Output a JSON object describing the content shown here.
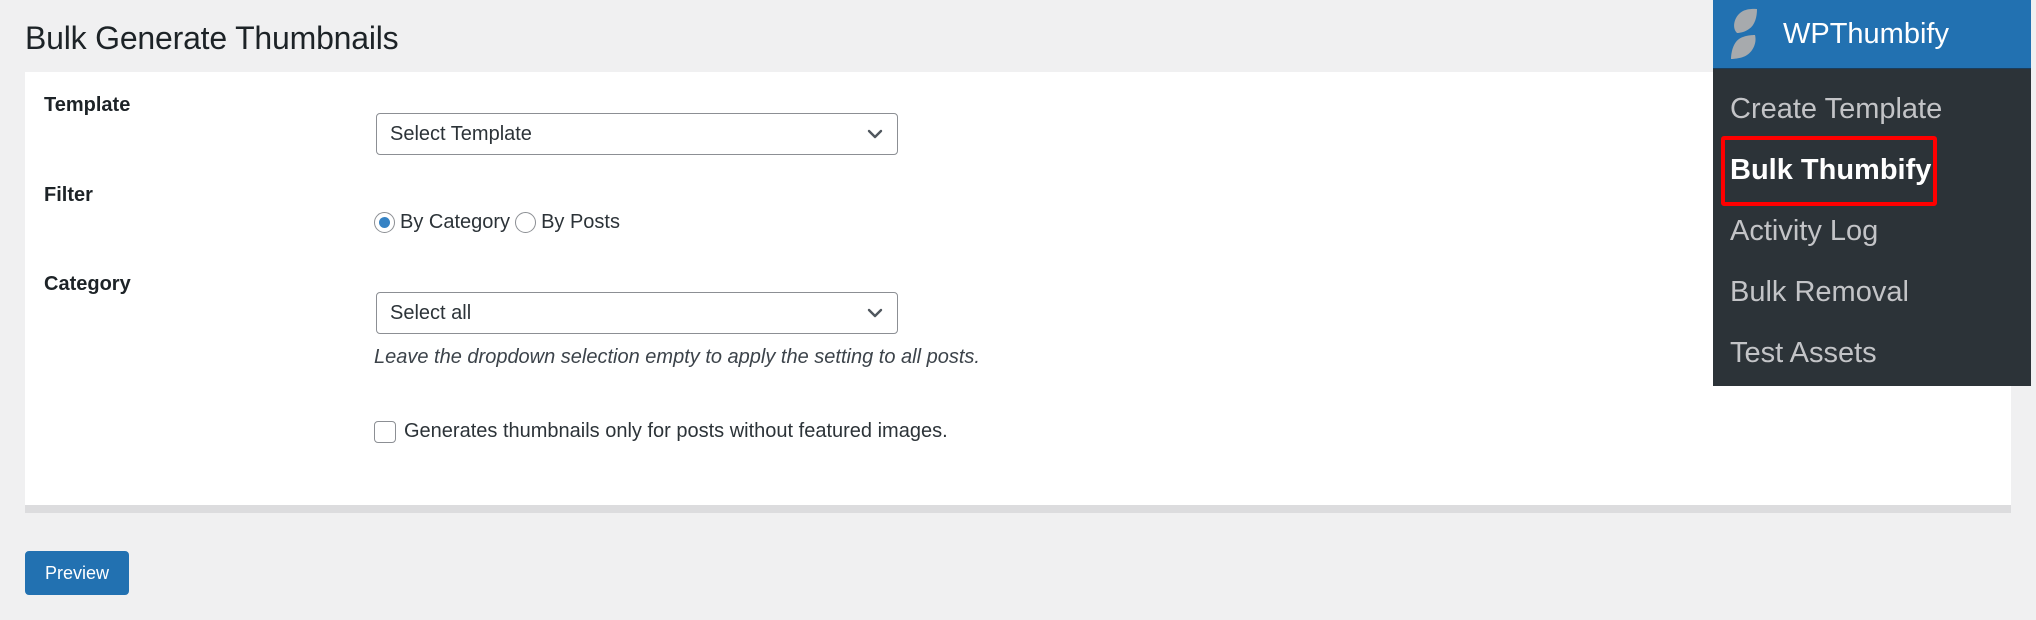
{
  "page": {
    "title": "Bulk Generate Thumbnails"
  },
  "form": {
    "template": {
      "label": "Template",
      "selected": "Select Template"
    },
    "filter": {
      "label": "Filter",
      "options": [
        {
          "label": "By Category",
          "checked": true
        },
        {
          "label": "By Posts",
          "checked": false
        }
      ]
    },
    "category": {
      "label": "Category",
      "selected": "Select all",
      "help_text": "Leave the dropdown selection empty to apply the setting to all posts."
    },
    "featured_only": {
      "label": "Generates thumbnails only for posts without featured images.",
      "checked": false
    }
  },
  "actions": {
    "preview_label": "Preview"
  },
  "flyout_menu": {
    "title": "WPThumbify",
    "items": [
      {
        "label": "Create Template",
        "active": false
      },
      {
        "label": "Bulk Thumbify",
        "active": true,
        "highlighted": true
      },
      {
        "label": "Activity Log",
        "active": false
      },
      {
        "label": "Bulk Removal",
        "active": false
      },
      {
        "label": "Test Assets",
        "active": false
      }
    ]
  },
  "colors": {
    "primary": "#2271b1",
    "menu_bg": "#2c3338",
    "highlight": "#ff0000",
    "page_bg": "#f0f0f1",
    "radio_checked": "#3582c4"
  }
}
